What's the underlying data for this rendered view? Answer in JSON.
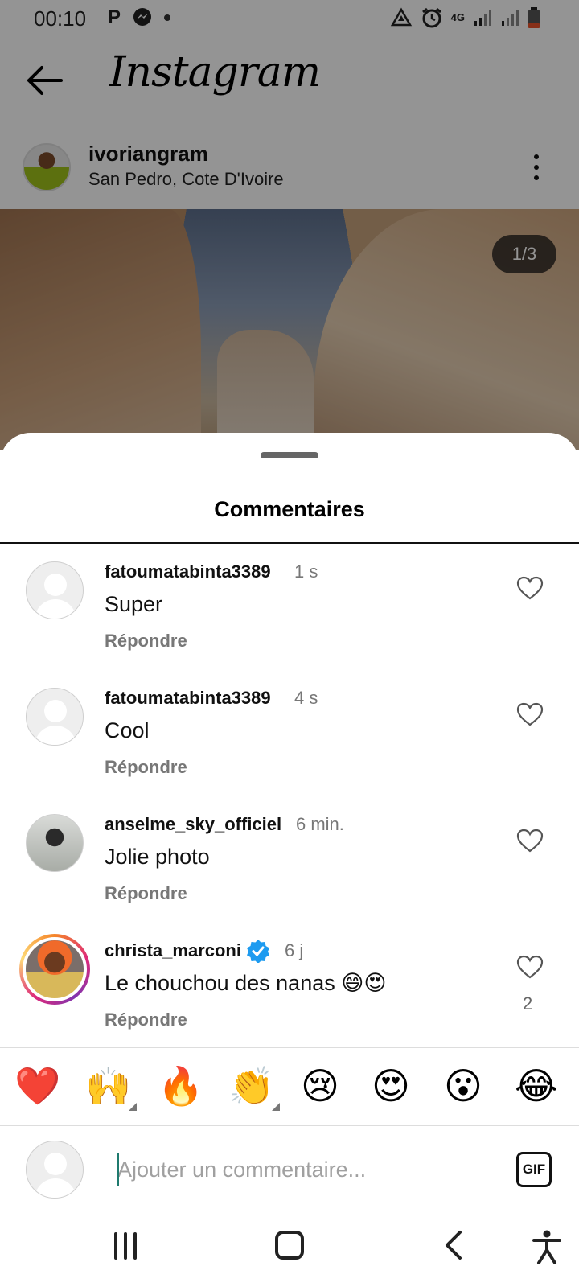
{
  "status_bar": {
    "time": "00:10",
    "left_icons": [
      "parking-icon",
      "messenger-icon",
      "notification-dot-icon"
    ],
    "right_icons": [
      "data-saver-icon",
      "alarm-icon",
      "4g-icon",
      "signal-icon",
      "signal-icon",
      "battery-low-icon"
    ],
    "network": "4G",
    "battery_color": "#e8542c"
  },
  "header": {
    "title": "Instagram",
    "back_icon": "arrow-left-icon"
  },
  "post": {
    "username": "ivoriangram",
    "location": "San Pedro, Cote D'Ivoire",
    "image_counter": "1/3",
    "more_icon": "more-vertical-icon"
  },
  "comments_sheet": {
    "title": "Commentaires",
    "comments": [
      {
        "username": "fatoumatabinta3389",
        "time": "1 s",
        "text": "Super",
        "reply_label": "Répondre",
        "likes": ""
      },
      {
        "username": "fatoumatabinta3389",
        "time": "4 s",
        "text": "Cool",
        "reply_label": "Répondre",
        "likes": ""
      },
      {
        "username": "anselme_sky_officiel",
        "time": "6 min.",
        "text": "Jolie photo",
        "reply_label": "Répondre",
        "likes": ""
      },
      {
        "username": "christa_marconi",
        "time": "6 j",
        "text": "Le chouchou des nanas 😄😍",
        "reply_label": "Répondre",
        "likes": "2",
        "verified": true
      }
    ]
  },
  "emoji_bar": [
    "❤️",
    "🙌",
    "🔥",
    "👏",
    "😢",
    "😍",
    "😮",
    "😂"
  ],
  "composer": {
    "placeholder": "Ajouter un commentaire...",
    "gif_label": "GIF"
  },
  "nav_bar": {
    "icons": [
      "recent-apps-icon",
      "home-icon",
      "back-icon",
      "accessibility-icon"
    ]
  },
  "colors": {
    "accent_blue": "#1d9bf0",
    "story_ring": "#dd2a7b",
    "muted_text": "#777777"
  }
}
